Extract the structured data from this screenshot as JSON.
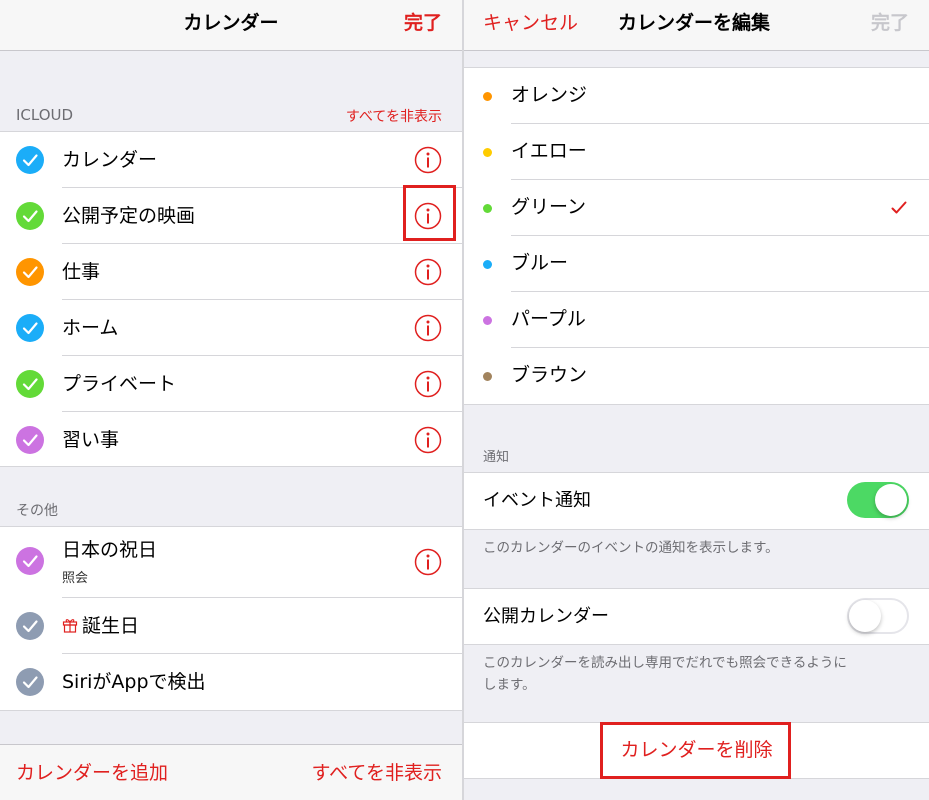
{
  "left": {
    "nav": {
      "title": "カレンダー",
      "done_label": "完了"
    },
    "icloud_section": {
      "header": "ICLOUD",
      "hide_all_label": "すべてを非表示",
      "items": [
        {
          "label": "カレンダー",
          "color": "#1badf8"
        },
        {
          "label": "公開予定の映画",
          "color": "#63da38"
        },
        {
          "label": "仕事",
          "color": "#ff9500"
        },
        {
          "label": "ホーム",
          "color": "#1badf8"
        },
        {
          "label": "プライベート",
          "color": "#63da38"
        },
        {
          "label": "習い事",
          "color": "#cc73e1"
        }
      ]
    },
    "other_section": {
      "header": "その他",
      "items": [
        {
          "label": "日本の祝日",
          "subtitle": "照会",
          "color": "#cc73e1"
        },
        {
          "label": "誕生日",
          "color": "#8e9cb2",
          "icon": "gift-icon"
        },
        {
          "label": "SiriがAppで検出",
          "color": "#8e9cb2"
        }
      ]
    },
    "toolbar": {
      "add_label": "カレンダーを追加",
      "hide_all_label": "すべてを非表示"
    }
  },
  "right": {
    "nav": {
      "cancel_label": "キャンセル",
      "title": "カレンダーを編集",
      "done_label": "完了"
    },
    "colors": [
      {
        "label": "オレンジ",
        "color": "#ff9500"
      },
      {
        "label": "イエロー",
        "color": "#ffcc00"
      },
      {
        "label": "グリーン",
        "color": "#63da38",
        "selected": true
      },
      {
        "label": "ブルー",
        "color": "#1badf8"
      },
      {
        "label": "パープル",
        "color": "#cc73e1"
      },
      {
        "label": "ブラウン",
        "color": "#a2845e"
      }
    ],
    "notify_section": {
      "header": "通知",
      "event_notify_label": "イベント通知",
      "event_notify_on": true,
      "event_notify_footnote": "このカレンダーのイベントの通知を表示します。"
    },
    "public_section": {
      "label": "公開カレンダー",
      "on": false,
      "footnote_line1": "このカレンダーを読み出し専用でだれでも照会できるように",
      "footnote_line2": "します。"
    },
    "delete_label": "カレンダーを削除"
  },
  "theme": {
    "accent": "#e0201f",
    "toggle_on": "#4cd964",
    "disabled": "#c7c7cc"
  }
}
